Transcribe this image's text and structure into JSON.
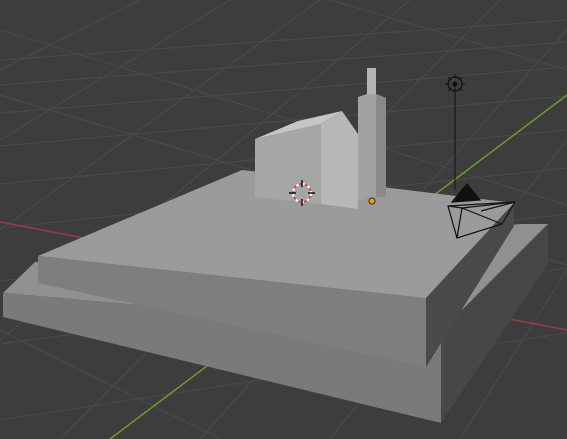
{
  "viewport": {
    "shading": "solid",
    "background_color": "#3d3d3d",
    "grid_color": "#4a4a4a",
    "x_axis_color": "#9a3c46",
    "y_axis_color": "#6f9a2a"
  },
  "scene": {
    "objects": [
      {
        "name": "base-plinth",
        "kind": "mesh"
      },
      {
        "name": "upper-platform",
        "kind": "mesh"
      },
      {
        "name": "house",
        "kind": "mesh"
      },
      {
        "name": "tower",
        "kind": "mesh"
      },
      {
        "name": "camera",
        "kind": "camera"
      },
      {
        "name": "light",
        "kind": "point-light"
      }
    ],
    "icons": [
      "3d-cursor-icon",
      "origin-dot-icon",
      "camera-icon",
      "light-icon"
    ]
  }
}
